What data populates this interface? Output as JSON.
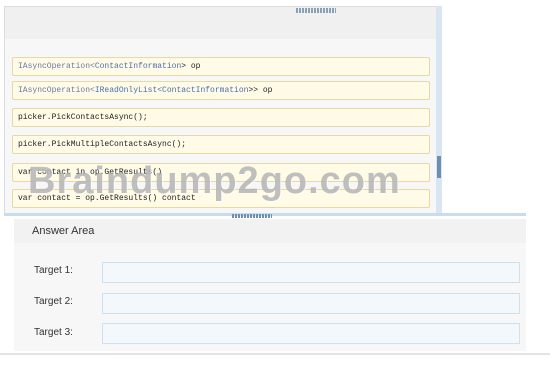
{
  "code_snippets": [
    {
      "type": "IAsyncOperation",
      "generic": "ContactInformation",
      "rest": "> op"
    },
    {
      "type": "IAsyncOperation",
      "generic": "IReadOnlyList<ContactInformation",
      "rest": ">> op"
    },
    {
      "text": "picker.PickContactsAsync();"
    },
    {
      "text": "picker.PickMultipleContactsAsync();"
    },
    {
      "text": "var contact in op.GetResults()"
    },
    {
      "text": "var contact = op.GetResults() contact"
    }
  ],
  "watermark": "Braindump2go.com",
  "answer_area": {
    "title": "Answer Area",
    "targets": [
      {
        "label": "Target 1:"
      },
      {
        "label": "Target 2:"
      },
      {
        "label": "Target 3:"
      }
    ]
  }
}
